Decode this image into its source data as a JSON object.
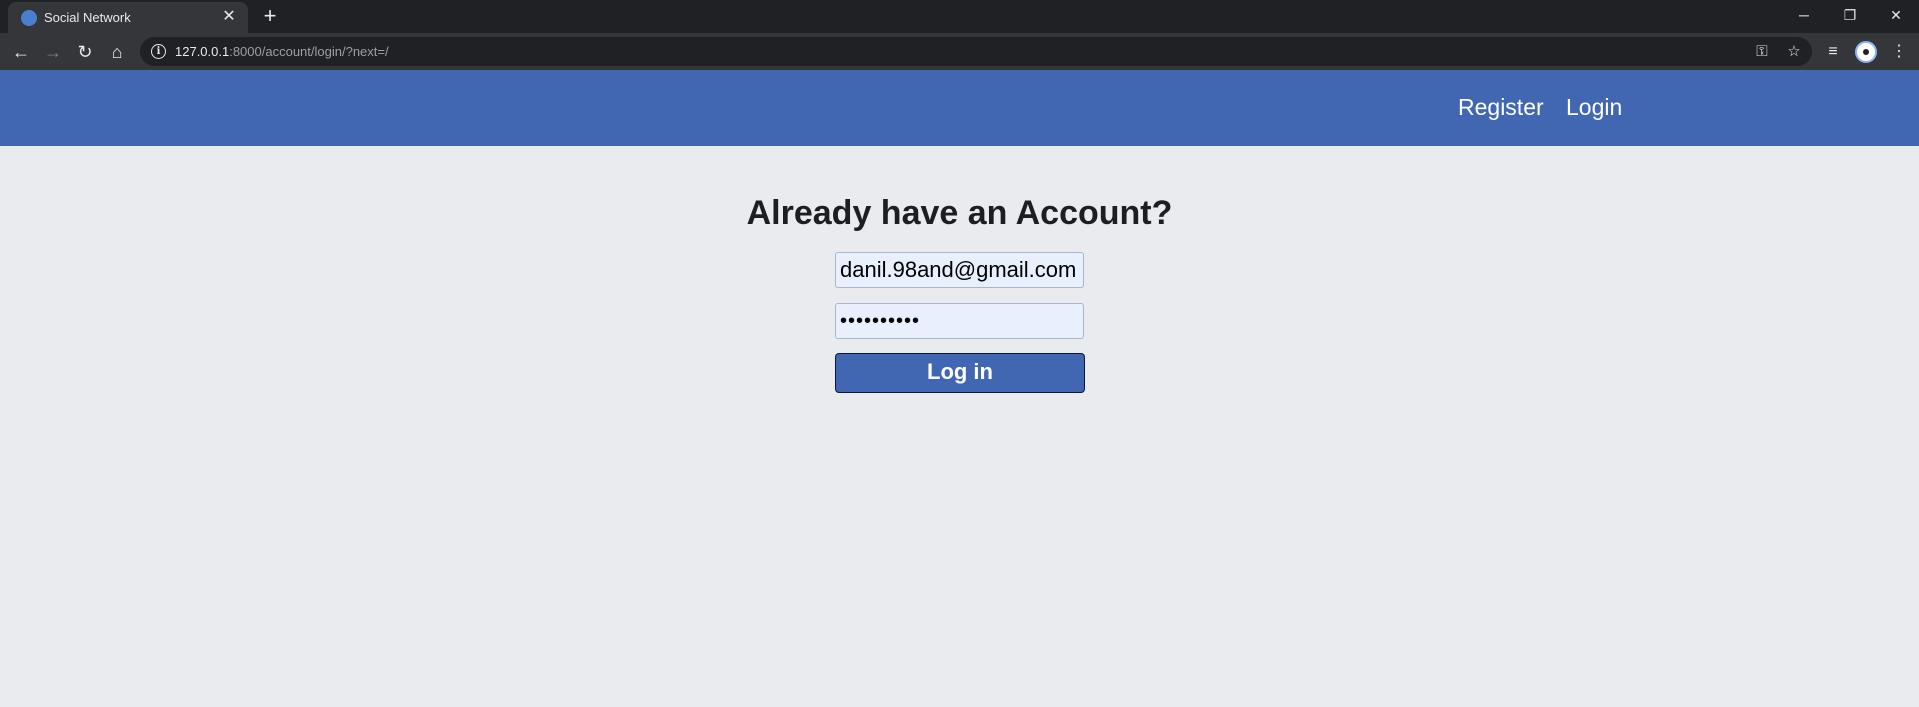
{
  "browser": {
    "tab": {
      "title": "Social Network",
      "favicon": "globe-icon",
      "close_glyph": "✕"
    },
    "new_tab_glyph": "+",
    "window_controls": {
      "minimize": "─",
      "restore": "❐",
      "close": "✕"
    },
    "nav": {
      "back": "←",
      "forward": "→",
      "reload": "↻",
      "home": "⌂"
    },
    "address": {
      "host": "127.0.0.1",
      "path": ":8000/account/login/?next=/"
    },
    "omnibox_icons": {
      "key": "⚿",
      "star": "☆"
    },
    "extensions": {
      "media": "≡",
      "menu": "⋮"
    }
  },
  "site_nav": {
    "register": "Register",
    "login": "Login"
  },
  "login_form": {
    "heading": "Already have an Account?",
    "email_value": "danil.98and@gmail.com",
    "password_value": "••••••••••",
    "submit_label": "Log in"
  },
  "colors": {
    "nav_bg": "#4267b2",
    "page_bg": "#e9ebee",
    "input_bg": "#e8f0fe",
    "button_bg": "#4267b2"
  }
}
